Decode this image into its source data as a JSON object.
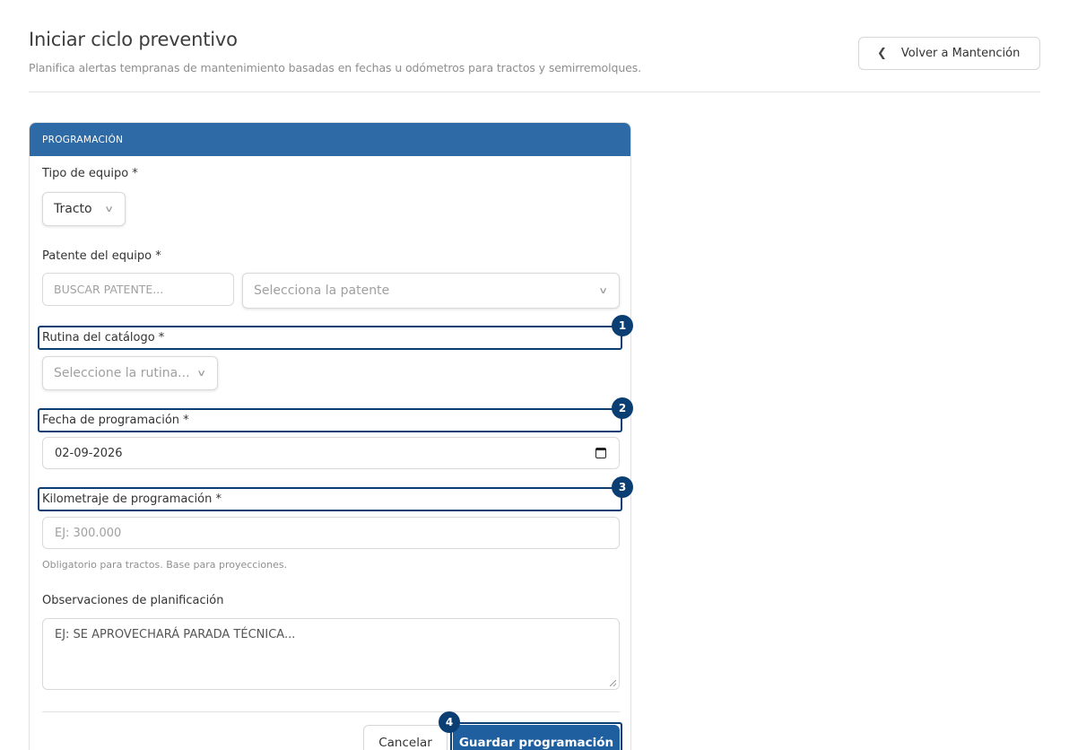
{
  "header": {
    "title": "Iniciar ciclo preventivo",
    "subtitle": "Planifica alertas tempranas de mantenimiento basadas en fechas u odómetros para tractos y semirremolques.",
    "back_label": "Volver a Mantención"
  },
  "card": {
    "section_title": "PROGRAMACIÓN",
    "equipment_type": {
      "label": "Tipo de equipo *",
      "value": "Tracto"
    },
    "plate": {
      "label": "Patente del equipo *",
      "search_placeholder": "BUSCAR PATENTE...",
      "select_placeholder": "Selecciona la patente"
    },
    "routine": {
      "label": "Rutina del catálogo *",
      "placeholder": "Seleccione la rutina..."
    },
    "date": {
      "label": "Fecha de programación *",
      "value": "02-09-2026"
    },
    "mileage": {
      "label": "Kilometraje de programación *",
      "placeholder": "EJ: 300.000",
      "hint": "Obligatorio para tractos. Base para proyecciones."
    },
    "notes": {
      "label": "Observaciones de planificación",
      "placeholder": "EJ: SE APROVECHARÁ PARADA TÉCNICA..."
    },
    "cancel_label": "Cancelar",
    "save_label": "Guardar programación"
  },
  "annotations": [
    "1",
    "2",
    "3",
    "4"
  ]
}
